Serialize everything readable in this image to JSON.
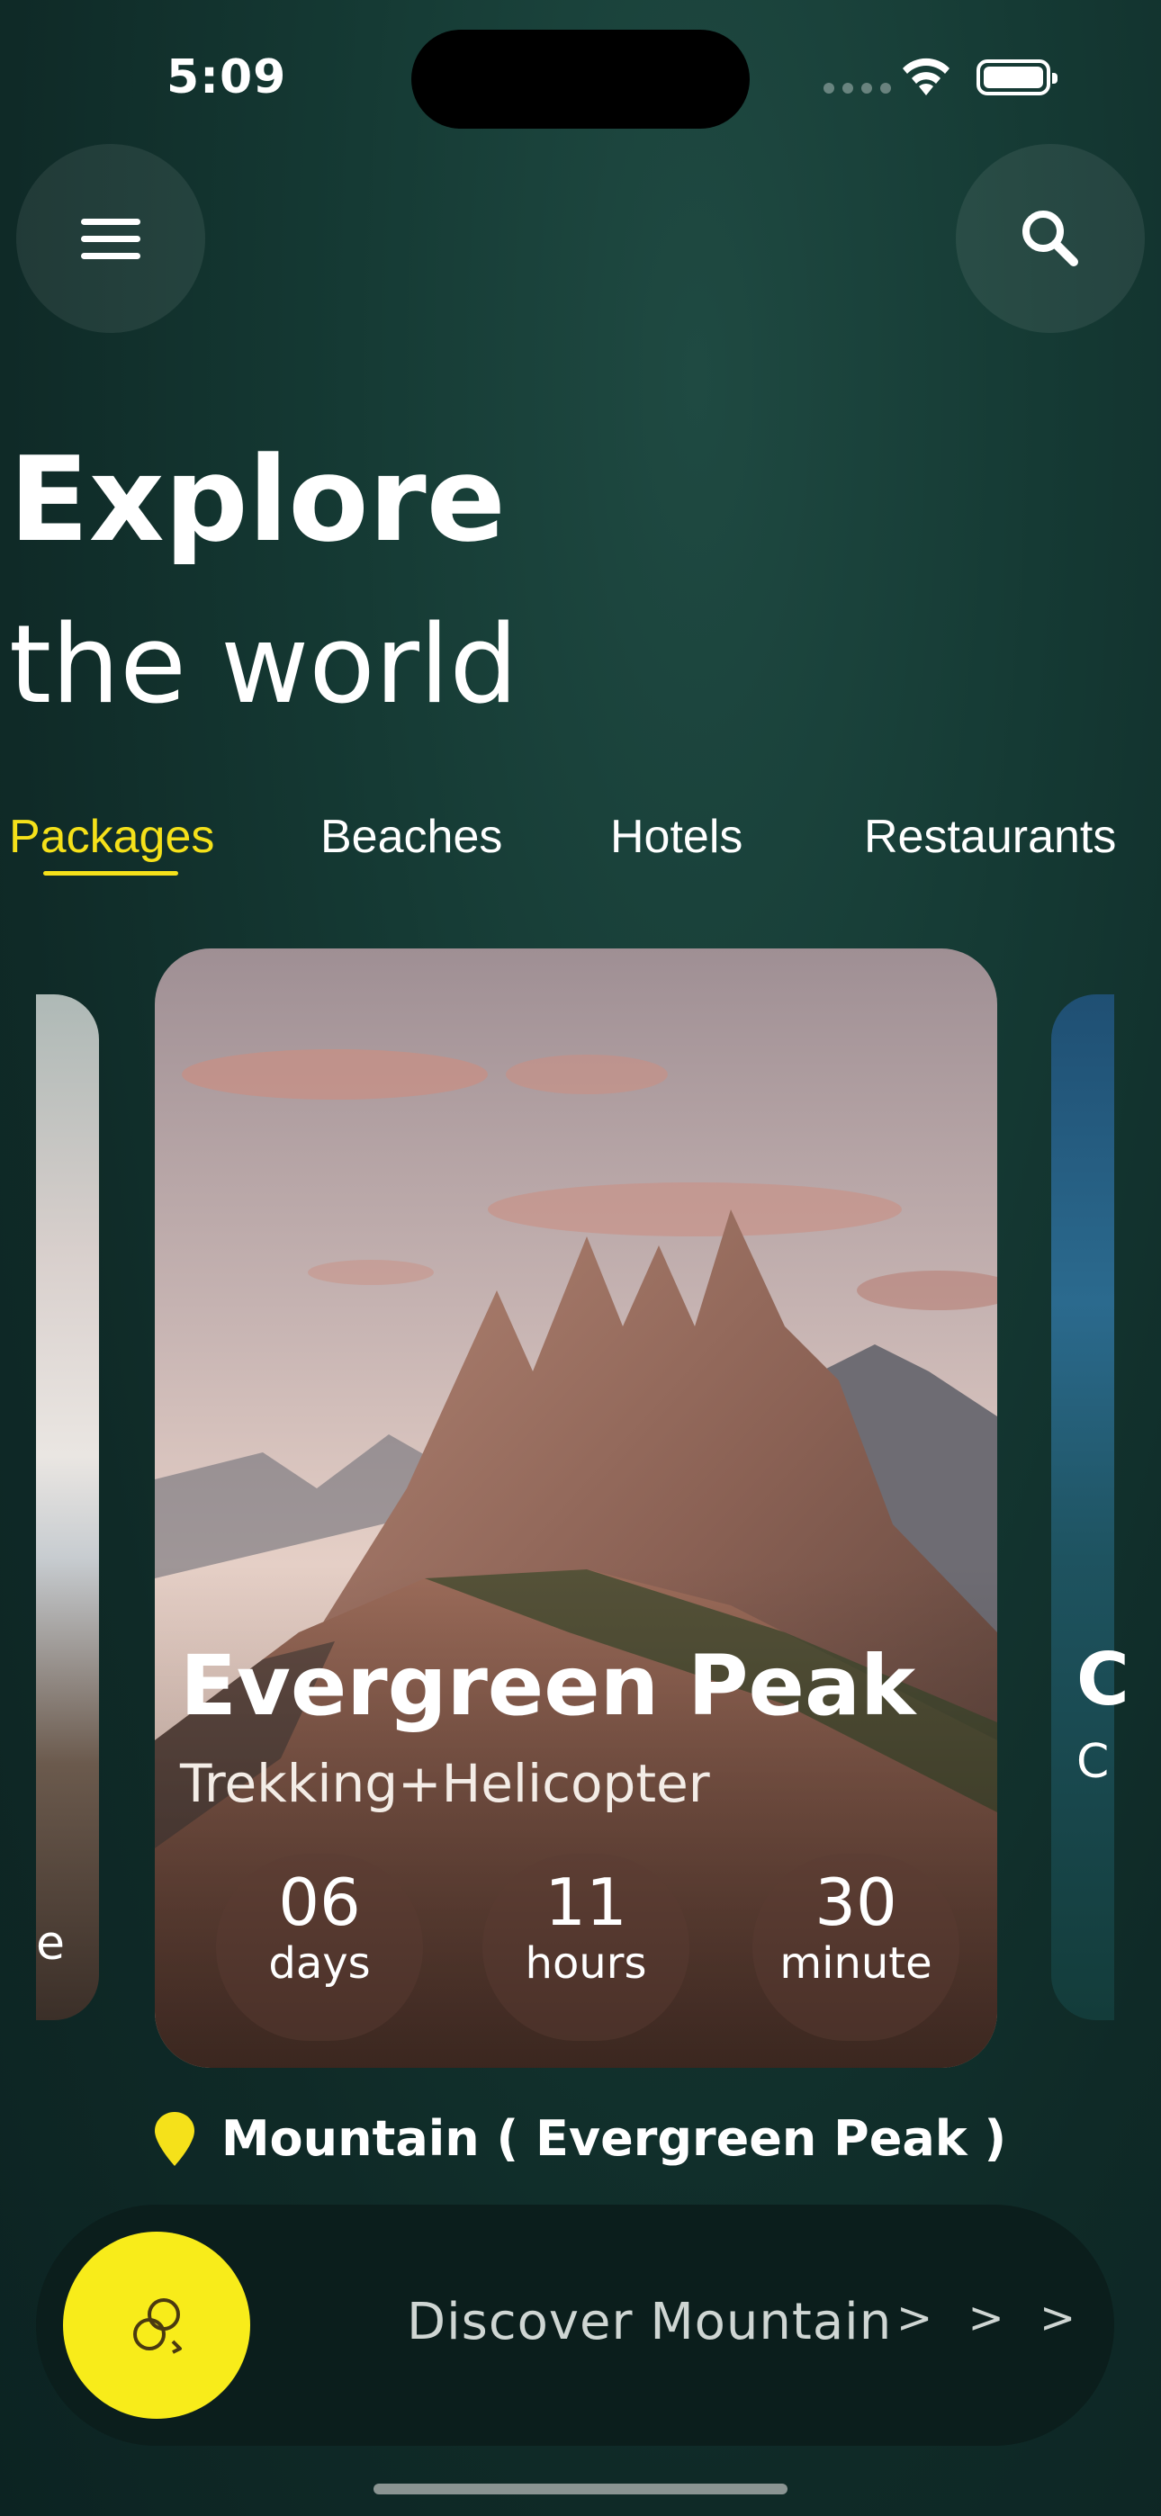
{
  "status_bar": {
    "time": "5:09"
  },
  "header": {
    "menu_icon": "hamburger-menu-icon",
    "search_icon": "search-icon"
  },
  "hero": {
    "line1": "Explore",
    "line2": "the world"
  },
  "tabs": [
    {
      "label": "Packages",
      "active": true
    },
    {
      "label": "Beaches",
      "active": false
    },
    {
      "label": "Hotels",
      "active": false
    },
    {
      "label": "Restaurants",
      "active": false
    }
  ],
  "card": {
    "title": "Evergreen Peak",
    "subtitle": "Trekking+Helicopter",
    "countdown": [
      {
        "value": "06",
        "unit": "days"
      },
      {
        "value": "11",
        "unit": "hours"
      },
      {
        "value": "30",
        "unit": "minute"
      }
    ]
  },
  "peek_right": {
    "letter": "C",
    "small": "C"
  },
  "peek_left": {
    "letter": "e"
  },
  "location": {
    "icon": "map-pin-icon",
    "text": "Mountain ( Evergreen Peak )"
  },
  "discover": {
    "icon": "explore-icon",
    "label": "Discover Mountain",
    "arrows": "> > >"
  },
  "colors": {
    "accent": "#f5e11a",
    "background": "#153a34"
  }
}
